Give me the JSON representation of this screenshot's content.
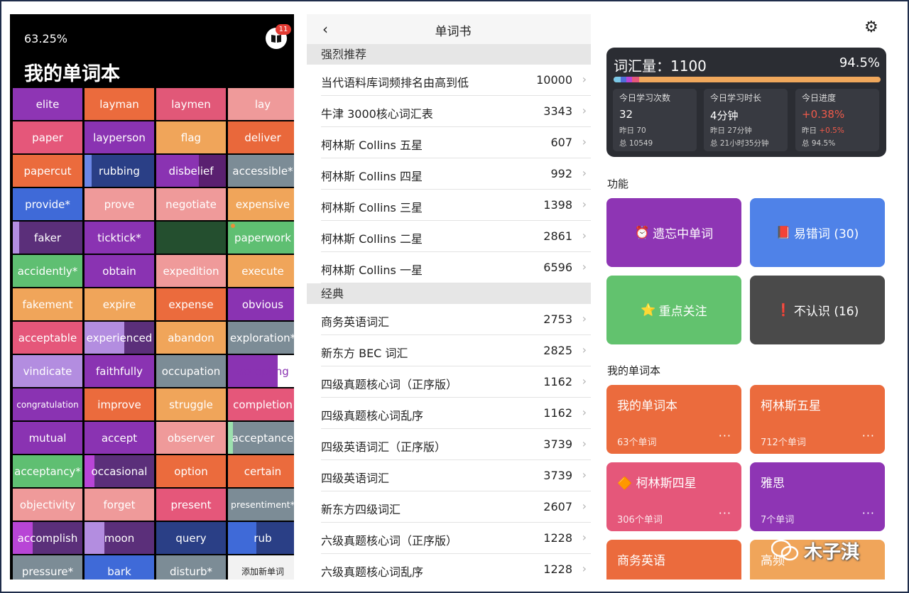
{
  "left": {
    "progress": "63.25%",
    "badge": "11",
    "title": "我的单词本",
    "cells": [
      {
        "t": "elite",
        "bg": "#8e35b4"
      },
      {
        "t": "layman",
        "bg": "#eb6b3d"
      },
      {
        "t": "laymen",
        "bg": "#e15878"
      },
      {
        "t": "lay",
        "bg": "#ef9a9a"
      },
      {
        "t": "paper",
        "bg": "#e5577a"
      },
      {
        "t": "layperson",
        "bg": "#8a33b2"
      },
      {
        "t": "flag",
        "bg": "#f0a55a"
      },
      {
        "t": "deliver",
        "bg": "#e9683b"
      },
      {
        "t": "papercut",
        "bg": "#eb6b3d"
      },
      {
        "t": "rubbing",
        "bg": "#2a3f86",
        "strip": "#6b86e5",
        "sl": 0,
        "sw": 10
      },
      {
        "t": "disbelief",
        "bg": "#8a33b2",
        "strip": "#5a2070",
        "sl": 60,
        "sw": 38
      },
      {
        "t": "accessible*",
        "bg": "#7c8c96"
      },
      {
        "t": "provide*",
        "bg": "#3f6ad8"
      },
      {
        "t": "prove",
        "bg": "#ef9a9a"
      },
      {
        "t": "negotiate",
        "bg": "#ef9a9a"
      },
      {
        "t": "expensive",
        "bg": "#f0a55a"
      },
      {
        "t": "faker",
        "bg": "#5b2f7a",
        "strip": "#b38de0",
        "sl": 0,
        "sw": 9
      },
      {
        "t": "ticktick*",
        "bg": "#8a33b2"
      },
      {
        "t": "",
        "bg": "#244f2f"
      },
      {
        "t": "paperwork",
        "bg": "#5fbf72",
        "dot": "#e98f3a"
      },
      {
        "t": "accidently*",
        "bg": "#5fbf72"
      },
      {
        "t": "obtain",
        "bg": "#8a33b2"
      },
      {
        "t": "expedition",
        "bg": "#ef9a9a"
      },
      {
        "t": "execute",
        "bg": "#f0a55a"
      },
      {
        "t": "fakement",
        "bg": "#f0a55a"
      },
      {
        "t": "expire",
        "bg": "#f0a55a"
      },
      {
        "t": "expense",
        "bg": "#eb6b3d"
      },
      {
        "t": "obvious",
        "bg": "#8a33b2"
      },
      {
        "t": "acceptable",
        "bg": "#e5577a"
      },
      {
        "t": "experienced",
        "bg": "#5b2f7a",
        "strip": "#b38de0",
        "sl": 0,
        "sw": 56
      },
      {
        "t": "abandon",
        "bg": "#f0a55a"
      },
      {
        "t": "exploration*",
        "bg": "#7c8c96"
      },
      {
        "t": "vindicate",
        "bg": "#b38de0"
      },
      {
        "t": "faithfully",
        "bg": "#8a33b2"
      },
      {
        "t": "occupation",
        "bg": "#7c8c96"
      },
      {
        "t": "accepting",
        "bg": "#ffffff",
        "fg": "#8a33b2",
        "strip": "#8a33b2",
        "sl": 0,
        "sw": 70
      },
      {
        "t": "congratulation",
        "bg": "#8a33b2",
        "small": true
      },
      {
        "t": "improve",
        "bg": "#eb6b3d"
      },
      {
        "t": "struggle",
        "bg": "#f0a55a"
      },
      {
        "t": "completion",
        "bg": "#e5577a"
      },
      {
        "t": "mutual",
        "bg": "#8a33b2"
      },
      {
        "t": "accept",
        "bg": "#8a33b2"
      },
      {
        "t": "observer",
        "bg": "#ef9a9a"
      },
      {
        "t": "acceptance",
        "bg": "#7c8c96",
        "strip": "#9ce0ae",
        "sl": 0,
        "sw": 7
      },
      {
        "t": "acceptancy*",
        "bg": "#5fbf72"
      },
      {
        "t": "occasional",
        "bg": "#5b2f7a",
        "strip": "#b845d6",
        "sl": 0,
        "sw": 14
      },
      {
        "t": "option",
        "bg": "#eb6b3d"
      },
      {
        "t": "certain",
        "bg": "#eb6b3d"
      },
      {
        "t": "objectivity",
        "bg": "#ef9a9a"
      },
      {
        "t": "forget",
        "bg": "#ef9a9a"
      },
      {
        "t": "present",
        "bg": "#e5577a"
      },
      {
        "t": "presentiment*",
        "bg": "#7c8c96",
        "small2": true
      },
      {
        "t": "accomplish",
        "bg": "#5b2f7a",
        "strip": "#b845d6",
        "sl": 0,
        "sw": 28
      },
      {
        "t": "moon",
        "bg": "#5b2f7a",
        "strip": "#b38de0",
        "sl": 0,
        "sw": 28
      },
      {
        "t": "query",
        "bg": "#2a3f86"
      },
      {
        "t": "rub",
        "bg": "#2a3f86",
        "strip": "#3f6ad8",
        "sl": 0,
        "sw": 40
      },
      {
        "t": "pressure*",
        "bg": "#7c8c96"
      },
      {
        "t": "bark",
        "bg": "#3f6ad8"
      },
      {
        "t": "disturb*",
        "bg": "#7c8c96"
      },
      {
        "t": "添加新单词",
        "bg": "#f2f2f2",
        "fg": "#222",
        "small": true
      }
    ]
  },
  "middle": {
    "title": "单词书",
    "back": "‹",
    "sections": [
      {
        "label": "强烈推荐",
        "items": [
          {
            "name": "当代语料库词频排名由高到低",
            "count": "10000"
          },
          {
            "name": "牛津 3000核心词汇表",
            "count": "3343"
          },
          {
            "name": "柯林斯 Collins 五星",
            "count": "607"
          },
          {
            "name": "柯林斯 Collins 四星",
            "count": "992"
          },
          {
            "name": "柯林斯 Collins 三星",
            "count": "1398"
          },
          {
            "name": "柯林斯 Collins 二星",
            "count": "2861"
          },
          {
            "name": "柯林斯 Collins 一星",
            "count": "6596"
          }
        ]
      },
      {
        "label": "经典",
        "items": [
          {
            "name": "商务英语词汇",
            "count": "2753"
          },
          {
            "name": "新东方 BEC 词汇",
            "count": "2825"
          },
          {
            "name": "四级真题核心词（正序版）",
            "count": "1162"
          },
          {
            "name": "四级真题核心词乱序",
            "count": "1162"
          },
          {
            "name": "四级英语词汇（正序版）",
            "count": "3739"
          },
          {
            "name": "四级英语词汇",
            "count": "3739"
          },
          {
            "name": "新东方四级词汇",
            "count": "2607"
          },
          {
            "name": "六级真题核心词（正序版）",
            "count": "1228"
          },
          {
            "name": "六级真题核心词乱序",
            "count": "1228"
          }
        ]
      }
    ]
  },
  "right": {
    "vocab_label": "词汇量：",
    "vocab_value": "1100",
    "vocab_pct": "94.5%",
    "stats": [
      {
        "title": "今日学习次数",
        "value": "32",
        "y": "昨日 70",
        "total": "总 10549"
      },
      {
        "title": "今日学习时长",
        "value": "4分钟",
        "y": "昨日 27分钟",
        "total": "总 21小时35分钟"
      },
      {
        "title": "今日进度",
        "value": "+0.38%",
        "y_label": "昨日",
        "y_value": "+0.5%",
        "total": "总 94.5%"
      }
    ],
    "func_heading": "功能",
    "functions": [
      {
        "icon": "⏰",
        "label": "遗忘中单词",
        "bg": "#8e35b4"
      },
      {
        "icon": "📕",
        "label": "易错词 (30)",
        "bg": "#4f82e8"
      },
      {
        "icon": "⭐",
        "label": "重点关注",
        "bg": "#62c26e"
      },
      {
        "icon": "❗",
        "label": "不认识 (16)",
        "bg": "#4a4a4a"
      }
    ],
    "books_heading": "我的单词本",
    "books": [
      {
        "title": "我的单词本",
        "count": "63个单词",
        "bg": "#eb6b3d"
      },
      {
        "title": "柯林斯五星",
        "count": "712个单词",
        "bg": "#eb6b3d"
      },
      {
        "title": "柯林斯四星",
        "count": "306个单词",
        "bg": "#e5577a",
        "icon": "🔶"
      },
      {
        "title": "雅思",
        "count": "7个单词",
        "bg": "#8e35b4"
      },
      {
        "title": "商务英语",
        "count": "",
        "bg": "#eb6b3d"
      },
      {
        "title": "高频",
        "count": "",
        "bg": "#f0a55a"
      }
    ],
    "more": "···",
    "watermark": "木子淇"
  }
}
